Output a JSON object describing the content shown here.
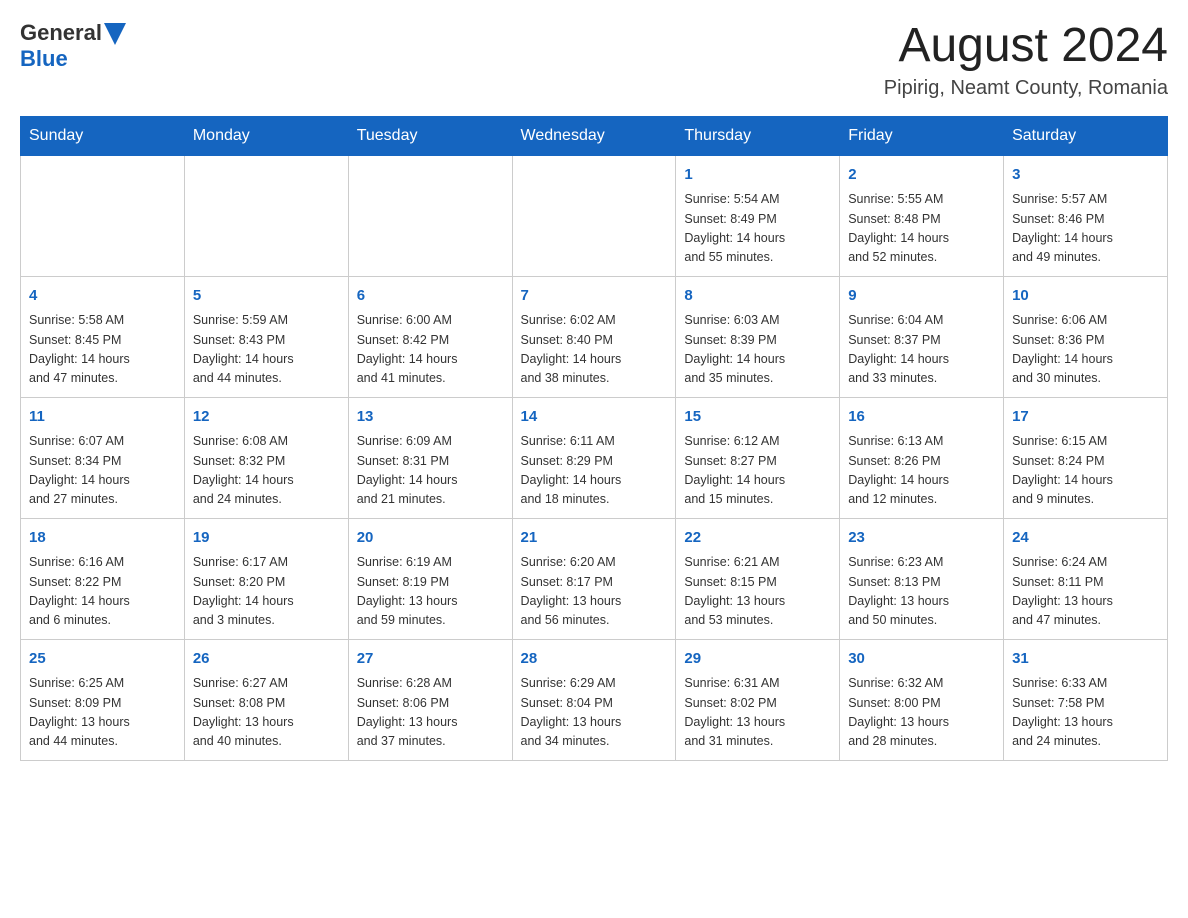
{
  "header": {
    "logo": {
      "general": "General",
      "blue": "Blue"
    },
    "title": "August 2024",
    "location": "Pipirig, Neamt County, Romania"
  },
  "calendar": {
    "days_of_week": [
      "Sunday",
      "Monday",
      "Tuesday",
      "Wednesday",
      "Thursday",
      "Friday",
      "Saturday"
    ],
    "weeks": [
      [
        {
          "day": "",
          "info": ""
        },
        {
          "day": "",
          "info": ""
        },
        {
          "day": "",
          "info": ""
        },
        {
          "day": "",
          "info": ""
        },
        {
          "day": "1",
          "info": "Sunrise: 5:54 AM\nSunset: 8:49 PM\nDaylight: 14 hours\nand 55 minutes."
        },
        {
          "day": "2",
          "info": "Sunrise: 5:55 AM\nSunset: 8:48 PM\nDaylight: 14 hours\nand 52 minutes."
        },
        {
          "day": "3",
          "info": "Sunrise: 5:57 AM\nSunset: 8:46 PM\nDaylight: 14 hours\nand 49 minutes."
        }
      ],
      [
        {
          "day": "4",
          "info": "Sunrise: 5:58 AM\nSunset: 8:45 PM\nDaylight: 14 hours\nand 47 minutes."
        },
        {
          "day": "5",
          "info": "Sunrise: 5:59 AM\nSunset: 8:43 PM\nDaylight: 14 hours\nand 44 minutes."
        },
        {
          "day": "6",
          "info": "Sunrise: 6:00 AM\nSunset: 8:42 PM\nDaylight: 14 hours\nand 41 minutes."
        },
        {
          "day": "7",
          "info": "Sunrise: 6:02 AM\nSunset: 8:40 PM\nDaylight: 14 hours\nand 38 minutes."
        },
        {
          "day": "8",
          "info": "Sunrise: 6:03 AM\nSunset: 8:39 PM\nDaylight: 14 hours\nand 35 minutes."
        },
        {
          "day": "9",
          "info": "Sunrise: 6:04 AM\nSunset: 8:37 PM\nDaylight: 14 hours\nand 33 minutes."
        },
        {
          "day": "10",
          "info": "Sunrise: 6:06 AM\nSunset: 8:36 PM\nDaylight: 14 hours\nand 30 minutes."
        }
      ],
      [
        {
          "day": "11",
          "info": "Sunrise: 6:07 AM\nSunset: 8:34 PM\nDaylight: 14 hours\nand 27 minutes."
        },
        {
          "day": "12",
          "info": "Sunrise: 6:08 AM\nSunset: 8:32 PM\nDaylight: 14 hours\nand 24 minutes."
        },
        {
          "day": "13",
          "info": "Sunrise: 6:09 AM\nSunset: 8:31 PM\nDaylight: 14 hours\nand 21 minutes."
        },
        {
          "day": "14",
          "info": "Sunrise: 6:11 AM\nSunset: 8:29 PM\nDaylight: 14 hours\nand 18 minutes."
        },
        {
          "day": "15",
          "info": "Sunrise: 6:12 AM\nSunset: 8:27 PM\nDaylight: 14 hours\nand 15 minutes."
        },
        {
          "day": "16",
          "info": "Sunrise: 6:13 AM\nSunset: 8:26 PM\nDaylight: 14 hours\nand 12 minutes."
        },
        {
          "day": "17",
          "info": "Sunrise: 6:15 AM\nSunset: 8:24 PM\nDaylight: 14 hours\nand 9 minutes."
        }
      ],
      [
        {
          "day": "18",
          "info": "Sunrise: 6:16 AM\nSunset: 8:22 PM\nDaylight: 14 hours\nand 6 minutes."
        },
        {
          "day": "19",
          "info": "Sunrise: 6:17 AM\nSunset: 8:20 PM\nDaylight: 14 hours\nand 3 minutes."
        },
        {
          "day": "20",
          "info": "Sunrise: 6:19 AM\nSunset: 8:19 PM\nDaylight: 13 hours\nand 59 minutes."
        },
        {
          "day": "21",
          "info": "Sunrise: 6:20 AM\nSunset: 8:17 PM\nDaylight: 13 hours\nand 56 minutes."
        },
        {
          "day": "22",
          "info": "Sunrise: 6:21 AM\nSunset: 8:15 PM\nDaylight: 13 hours\nand 53 minutes."
        },
        {
          "day": "23",
          "info": "Sunrise: 6:23 AM\nSunset: 8:13 PM\nDaylight: 13 hours\nand 50 minutes."
        },
        {
          "day": "24",
          "info": "Sunrise: 6:24 AM\nSunset: 8:11 PM\nDaylight: 13 hours\nand 47 minutes."
        }
      ],
      [
        {
          "day": "25",
          "info": "Sunrise: 6:25 AM\nSunset: 8:09 PM\nDaylight: 13 hours\nand 44 minutes."
        },
        {
          "day": "26",
          "info": "Sunrise: 6:27 AM\nSunset: 8:08 PM\nDaylight: 13 hours\nand 40 minutes."
        },
        {
          "day": "27",
          "info": "Sunrise: 6:28 AM\nSunset: 8:06 PM\nDaylight: 13 hours\nand 37 minutes."
        },
        {
          "day": "28",
          "info": "Sunrise: 6:29 AM\nSunset: 8:04 PM\nDaylight: 13 hours\nand 34 minutes."
        },
        {
          "day": "29",
          "info": "Sunrise: 6:31 AM\nSunset: 8:02 PM\nDaylight: 13 hours\nand 31 minutes."
        },
        {
          "day": "30",
          "info": "Sunrise: 6:32 AM\nSunset: 8:00 PM\nDaylight: 13 hours\nand 28 minutes."
        },
        {
          "day": "31",
          "info": "Sunrise: 6:33 AM\nSunset: 7:58 PM\nDaylight: 13 hours\nand 24 minutes."
        }
      ]
    ]
  }
}
